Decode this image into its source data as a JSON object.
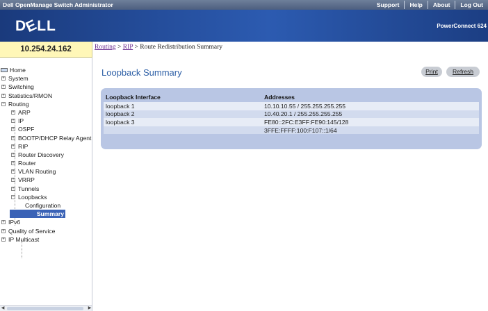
{
  "app_title": "Dell OpenManage Switch Administrator",
  "top_links": [
    "Support",
    "Help",
    "About",
    "Log Out"
  ],
  "logo_text": "D LL",
  "logo_e": "E",
  "model": "PowerConnect 624",
  "ip_address": "10.254.24.162",
  "breadcrumb": {
    "routing": "Routing",
    "sep1": ">",
    "rip": "RIP",
    "sep2": ">",
    "current": "Route Redistribution Summary"
  },
  "nav": [
    {
      "label": "Home",
      "icon": "home-icon"
    },
    {
      "label": "System",
      "expander": "+"
    },
    {
      "label": "Switching",
      "expander": "+"
    },
    {
      "label": "Statistics/RMON",
      "expander": "+"
    },
    {
      "label": "Routing",
      "expander": "−"
    },
    {
      "label": "ARP",
      "expander": "+"
    },
    {
      "label": "IP",
      "expander": "+"
    },
    {
      "label": "OSPF",
      "expander": "+"
    },
    {
      "label": "BOOTP/DHCP Relay Agent",
      "expander": "+"
    },
    {
      "label": "RIP",
      "expander": "+"
    },
    {
      "label": "Router Discovery",
      "expander": "+"
    },
    {
      "label": "Router",
      "expander": "+"
    },
    {
      "label": "VLAN Routing",
      "expander": "+"
    },
    {
      "label": "VRRP",
      "expander": "+"
    },
    {
      "label": "Tunnels",
      "expander": "+"
    },
    {
      "label": "Loopbacks",
      "expander": "−"
    },
    {
      "label": "Configuration"
    },
    {
      "label": "Summary"
    },
    {
      "label": "IPv6",
      "expander": "+"
    },
    {
      "label": "Quality of Service",
      "expander": "+"
    },
    {
      "label": "IP Multicast",
      "expander": "+"
    }
  ],
  "page_title": "Loopback Summary",
  "buttons": {
    "print": "Print",
    "refresh": "Refresh"
  },
  "table": {
    "headers": [
      "Loopback Interface",
      "Addresses"
    ],
    "rows": [
      [
        "loopback 1",
        "10.10.10.55 / 255.255.255.255"
      ],
      [
        "loopback 2",
        "10.40.20.1 / 255.255.255.255"
      ],
      [
        "loopback 3",
        "FE80::2FC:E3FF:FE90:145/128"
      ],
      [
        "",
        "3FFE:FFFF:100:F107::1/64"
      ]
    ]
  }
}
